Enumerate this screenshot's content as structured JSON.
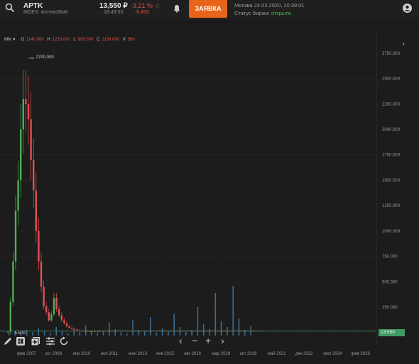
{
  "header": {
    "ticker": "APTK",
    "exchange": "MOEX: Аптеки36и6",
    "price": "13,550 ₽",
    "change_pct": "-3,21 %",
    "quote_time": "18:49:03",
    "change_abs": "-0,450",
    "order_button": "ЗАЯВКА",
    "market_time": "Москва 24.03.2020, 20:39:01",
    "market_status_label": "Статус биржи:",
    "market_status_value": "открыта"
  },
  "legend": {
    "interval": "MN",
    "open_label": "O",
    "open": "1140.000",
    "high_label": "H",
    "high": "1220.000",
    "low_label": "L",
    "low": "999.000",
    "close_label": "C",
    "close": "1139.000",
    "volume_label": "V",
    "volume": "560"
  },
  "annotations": {
    "peak": "2700.000",
    "low": "5.500",
    "last_price": "13.550"
  },
  "colors": {
    "accent": "#e8641b",
    "up": "#4cb050",
    "down": "#e05050",
    "volume": "#3b6a94",
    "last_price": "#3e9a62"
  },
  "chart_data": {
    "type": "candlestick",
    "y_ticks": [
      "2750.000",
      "2500.000",
      "2250.000",
      "2000.000",
      "1750.000",
      "1500.000",
      "1250.000",
      "1000.000",
      "750.000",
      "500.000",
      "250.000"
    ],
    "y_tick_values": [
      2750,
      2500,
      2250,
      2000,
      1750,
      1500,
      1250,
      1000,
      750,
      500,
      250
    ],
    "ylim": [
      -30,
      2770
    ],
    "x_ticks": [
      "фев 2007",
      "окт 2008",
      "апр 2010",
      "ноя 2011",
      "июн 2013",
      "янв 2015",
      "авг 2016",
      "мар 2018",
      "окт 2019",
      "май 2021",
      "дек 2022",
      "июл 2024",
      "фев 2026"
    ],
    "series_close": [
      5.5,
      300,
      700,
      1200,
      1500,
      2000,
      2300,
      2250,
      2100,
      1700,
      1400,
      1000,
      700,
      450,
      260,
      200,
      120,
      180,
      340,
      230,
      170,
      120,
      90,
      60,
      45,
      35,
      28,
      20,
      18,
      16,
      15,
      14,
      14,
      13,
      13.5,
      14,
      13.55
    ],
    "peak_value": 2700,
    "last_value": 13.55
  },
  "toolbar": {
    "icons": [
      "pencil-icon",
      "template-icon",
      "indicators-icon",
      "settings-icon",
      "reset-icon"
    ],
    "nav": [
      "‹",
      "−",
      "+",
      "›"
    ]
  }
}
